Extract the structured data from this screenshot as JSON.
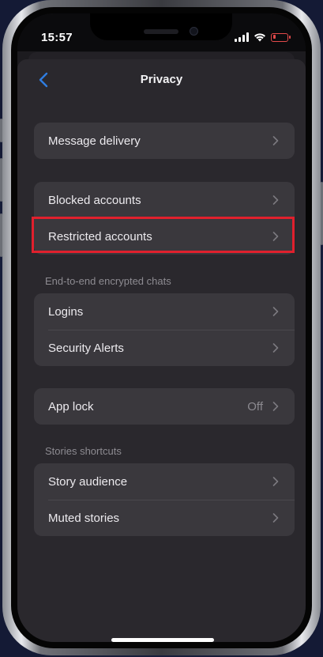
{
  "status_bar": {
    "time": "15:57"
  },
  "nav": {
    "title": "Privacy",
    "back_icon": "chevron-left-icon"
  },
  "groups": {
    "delivery": {
      "items": [
        {
          "label": "Message delivery"
        }
      ]
    },
    "accounts": {
      "items": [
        {
          "label": "Blocked accounts"
        },
        {
          "label": "Restricted accounts",
          "highlighted": true
        }
      ]
    },
    "e2e": {
      "header": "End-to-end encrypted chats",
      "items": [
        {
          "label": "Logins"
        },
        {
          "label": "Security Alerts"
        }
      ]
    },
    "applock": {
      "items": [
        {
          "label": "App lock",
          "value": "Off"
        }
      ]
    },
    "stories": {
      "header": "Stories shortcuts",
      "items": [
        {
          "label": "Story audience"
        },
        {
          "label": "Muted stories"
        }
      ]
    }
  },
  "colors": {
    "accent": "#2f7de1",
    "highlight": "#e0202d",
    "row_bg": "#3a383d",
    "sheet_bg": "#2a282d"
  }
}
